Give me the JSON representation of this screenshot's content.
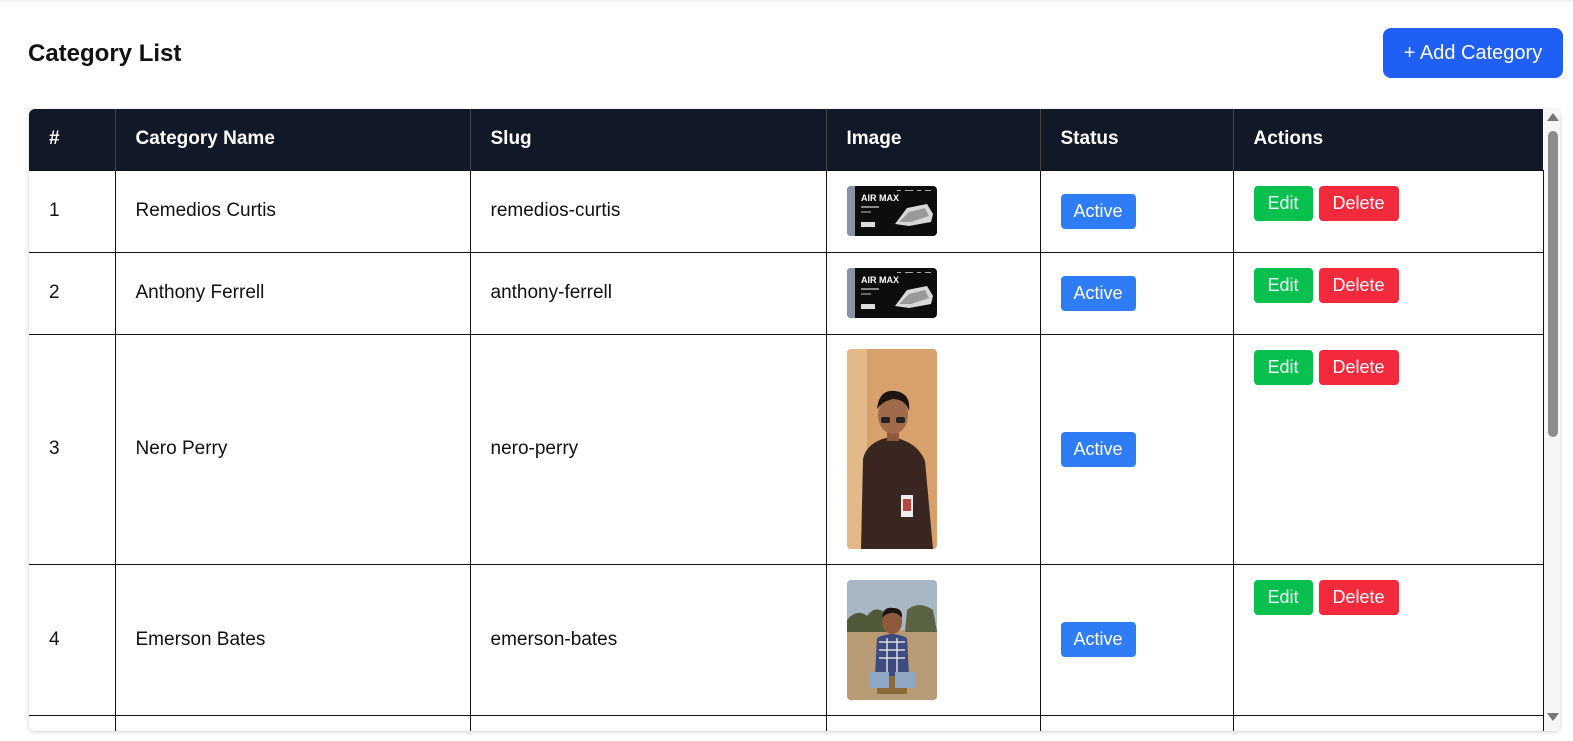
{
  "header": {
    "title": "Category List",
    "add_button_label": "+ Add Category"
  },
  "table": {
    "columns": [
      "#",
      "Category Name",
      "Slug",
      "Image",
      "Status",
      "Actions"
    ],
    "rows": [
      {
        "index": "1",
        "name": "Remedios Curtis",
        "slug": "remedios-curtis",
        "image": "sneaker-banner-image",
        "status": "Active",
        "edit_label": "Edit",
        "delete_label": "Delete"
      },
      {
        "index": "2",
        "name": "Anthony Ferrell",
        "slug": "anthony-ferrell",
        "image": "sneaker-banner-image",
        "status": "Active",
        "edit_label": "Edit",
        "delete_label": "Delete"
      },
      {
        "index": "3",
        "name": "Nero Perry",
        "slug": "nero-perry",
        "image": "person-portrait-image",
        "status": "Active",
        "edit_label": "Edit",
        "delete_label": "Delete"
      },
      {
        "index": "4",
        "name": "Emerson Bates",
        "slug": "emerson-bates",
        "image": "person-outdoor-image",
        "status": "Active",
        "edit_label": "Edit",
        "delete_label": "Delete"
      }
    ],
    "banner_text": "AIR MAX"
  },
  "colors": {
    "header_bg": "#111827",
    "primary": "#1f5ff5",
    "status_active": "#2f7df6",
    "edit": "#08c04d",
    "delete": "#f22a3c"
  }
}
